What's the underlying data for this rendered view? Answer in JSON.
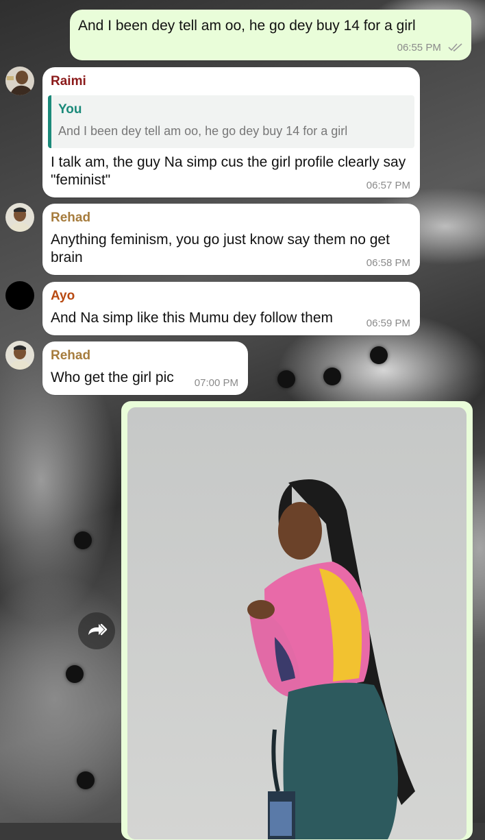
{
  "messages": [
    {
      "text": "And I been dey tell am oo, he go dey buy 14 for a girl",
      "time": "06:55 PM"
    },
    {
      "sender": "Raimi",
      "quote_author": "You",
      "quote_text": "And I been dey tell am oo, he go dey buy 14 for a girl",
      "text": "I talk am, the guy Na simp cus the girl profile clearly say \"feminist\"",
      "time": "06:57 PM"
    },
    {
      "sender": "Rehad",
      "text": "Anything feminism, you go just know say them no get brain",
      "time": "06:58 PM"
    },
    {
      "sender": "Ayo",
      "text": "And Na simp like this Mumu dey follow them",
      "time": "06:59 PM"
    },
    {
      "sender": "Rehad",
      "text": "Who get the girl pic",
      "time": "07:00 PM"
    }
  ],
  "colors": {
    "outgoing_bubble": "#e9fdd9",
    "incoming_bubble": "#ffffff",
    "raimi_name": "#8b1a1a",
    "rehad_name": "#a67c3d",
    "ayo_name": "#b84a12",
    "quote_accent": "#1b8a7a",
    "time_text": "#8a8a8a"
  },
  "icons": {
    "read_receipt": "double-check-icon",
    "forward": "forward-icon"
  }
}
